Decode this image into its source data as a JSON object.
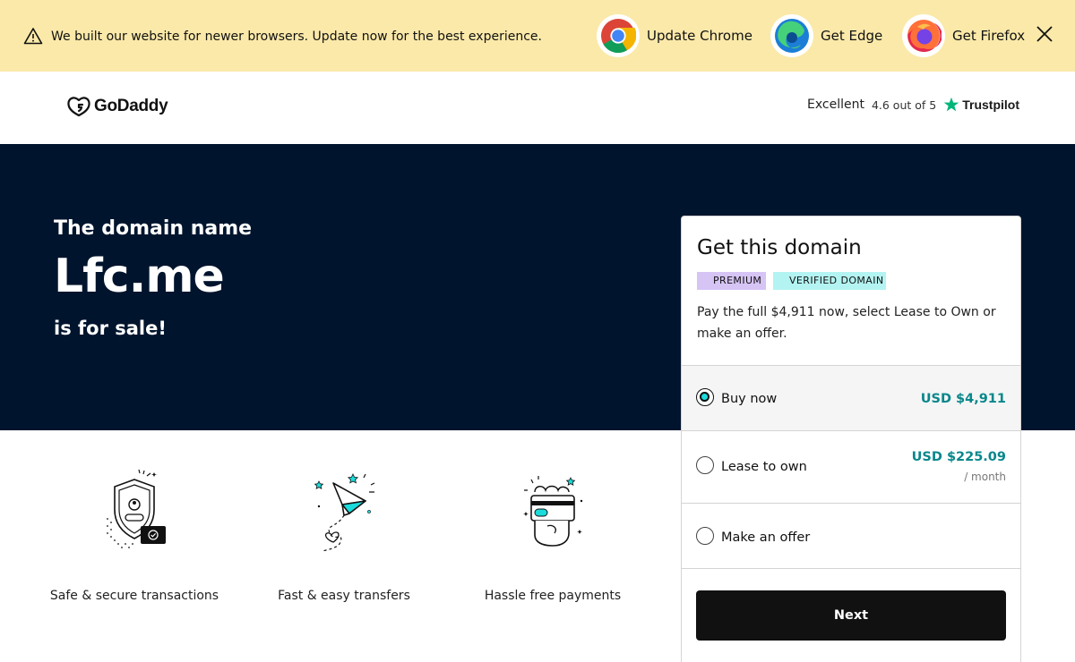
{
  "banner": {
    "message": "We built our website for newer browsers. Update now for the best experience.",
    "browsers": [
      {
        "label": "Update Chrome",
        "icon": "chrome-icon"
      },
      {
        "label": "Get Edge",
        "icon": "edge-icon"
      },
      {
        "label": "Get Firefox",
        "icon": "firefox-icon"
      }
    ]
  },
  "header": {
    "brand": "GoDaddy",
    "trustpilot": {
      "rating_word": "Excellent",
      "score": "4.6 out of 5",
      "brand": "Trustpilot",
      "star_color": "#00b67a"
    }
  },
  "hero": {
    "pre": "The domain name",
    "domain": "Lfc.me",
    "post": "is for sale!",
    "background": "#00142d"
  },
  "features": [
    {
      "caption": "Safe & secure transactions",
      "icon": "shield-icon"
    },
    {
      "caption": "Fast & easy transfers",
      "icon": "paper-plane-icon"
    },
    {
      "caption": "Hassle free payments",
      "icon": "payment-card-icon"
    }
  ],
  "card": {
    "title": "Get this domain",
    "badges": [
      "PREMIUM",
      "VERIFIED DOMAIN"
    ],
    "description": "Pay the full $4,911 now, select Lease to Own or make an offer.",
    "options": [
      {
        "label": "Buy now",
        "price": "USD $4,911",
        "selected": true
      },
      {
        "label": "Lease to own",
        "price": "USD $225.09",
        "per": "/ month",
        "selected": false
      },
      {
        "label": "Make an offer",
        "selected": false
      }
    ],
    "next_label": "Next",
    "accent_color": "#09878b"
  }
}
